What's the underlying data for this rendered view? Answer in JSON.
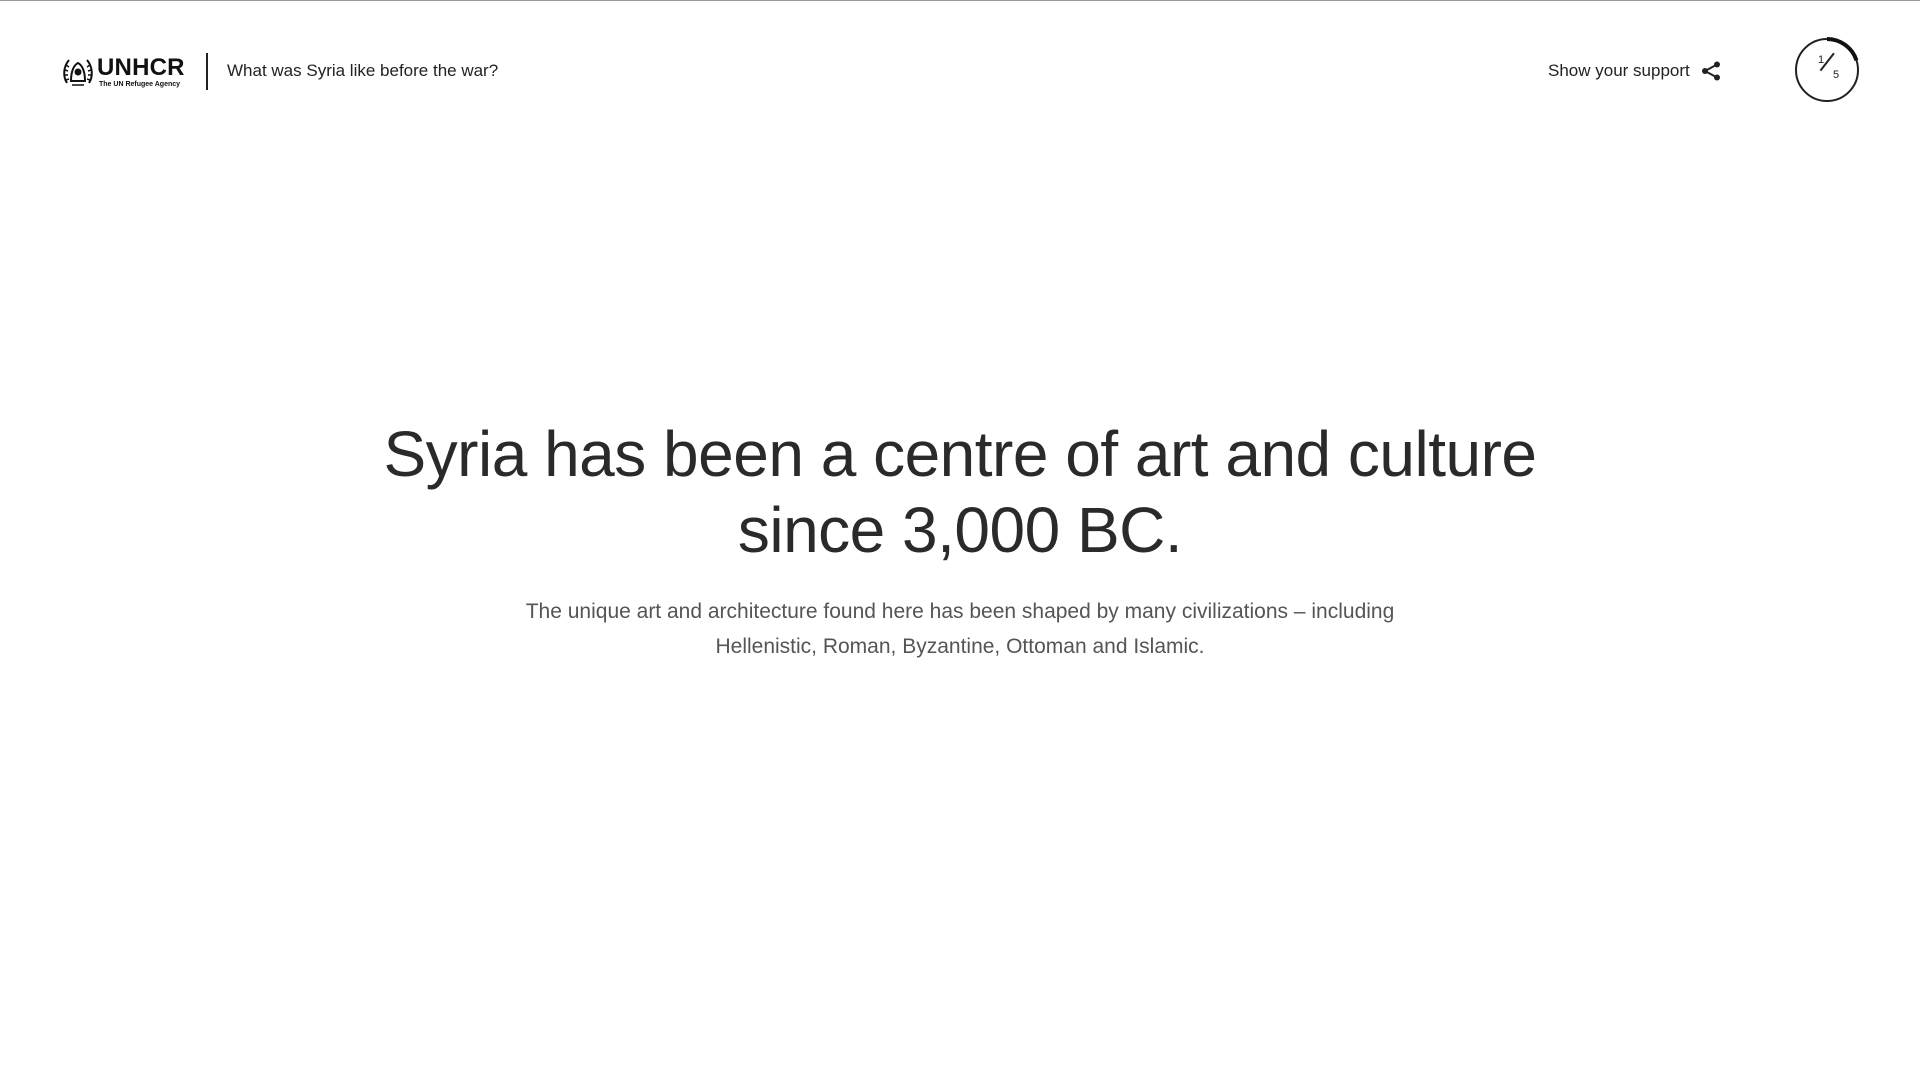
{
  "header": {
    "logo": {
      "wordmark": "UNHCR",
      "tagline": "The UN Refugee Agency",
      "icon": "unhcr-emblem-icon"
    },
    "story_title": "What was Syria like before the war?",
    "support": {
      "label": "Show your support",
      "icon": "share-icon"
    },
    "progress": {
      "current": "1",
      "total": "5",
      "fraction": 0.2
    }
  },
  "main": {
    "headline": "Syria has been a centre of art and culture since 3,000 BC.",
    "subtext": "The unique art and architecture found here has been shaped by many civilizations – including Hellenistic, Roman, Byzantine, Ottoman and Islamic."
  },
  "colors": {
    "background": "#ffffff",
    "text": "#222222",
    "subtext": "#555555"
  }
}
